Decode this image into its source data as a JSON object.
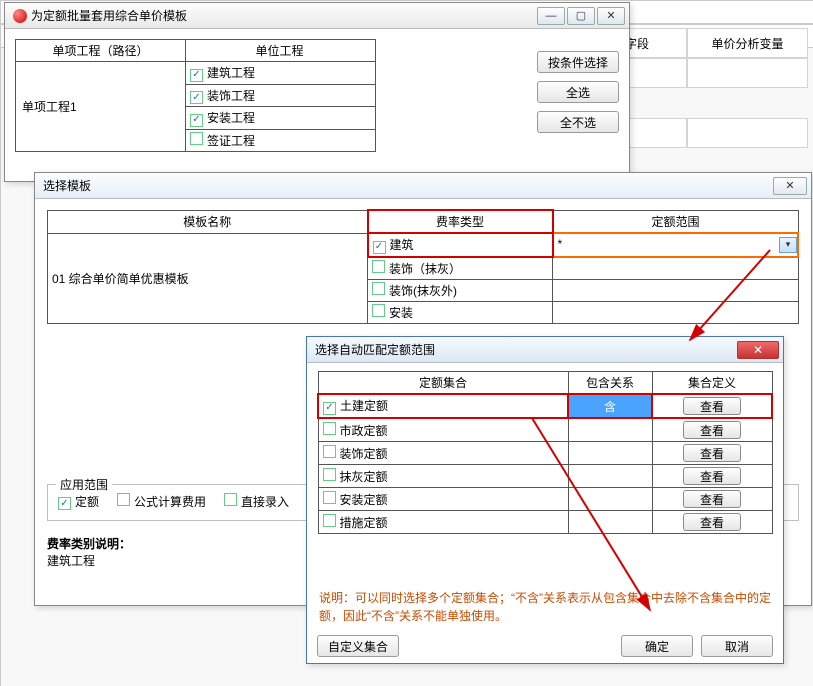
{
  "bg": {
    "col_a_header": "字段",
    "col_b_header": "单价分析变量",
    "row1_a": ""
  },
  "d1": {
    "title": "为定额批量套用综合单价模板",
    "col_path": "单项工程（路径）",
    "col_unit": "单位工程",
    "path_val": "单项工程1",
    "units": [
      {
        "label": "建筑工程",
        "on": true
      },
      {
        "label": "装饰工程",
        "on": true
      },
      {
        "label": "安装工程",
        "on": true
      },
      {
        "label": "签证工程",
        "on": false
      }
    ],
    "btn_filter": "按条件选择",
    "btn_all": "全选",
    "btn_none": "全不选"
  },
  "d2": {
    "title": "选择模板",
    "col_name": "模板名称",
    "col_rate": "费率类型",
    "col_range": "定额范围",
    "name_val": "01 综合单价简单优惠模板",
    "star": "*",
    "rates": [
      {
        "label": "建筑",
        "on": true,
        "hl": true
      },
      {
        "label": "装饰（抹灰）",
        "on": false
      },
      {
        "label": "装饰(抹灰外)",
        "on": false
      },
      {
        "label": "安装",
        "on": false
      }
    ],
    "scope_label": "应用范围",
    "scope_items": [
      {
        "label": "定额",
        "on": true
      },
      {
        "label": "公式计算费用",
        "on": false
      },
      {
        "label": "直接录入",
        "on": false
      }
    ],
    "note_label": "费率类别说明：",
    "note_body": "建筑工程"
  },
  "d3": {
    "title": "选择自动匹配定额范围",
    "col_set": "定额集合",
    "col_rel": "包含关系",
    "col_def": "集合定义",
    "btn_view": "查看",
    "rel_contain": "含",
    "rows": [
      {
        "label": "土建定额",
        "on": true,
        "hl": true
      },
      {
        "label": "市政定额",
        "on": false
      },
      {
        "label": "装饰定额",
        "on": false
      },
      {
        "label": "抹灰定额",
        "on": false
      },
      {
        "label": "安装定额",
        "on": false
      },
      {
        "label": "措施定额",
        "on": false
      }
    ],
    "desc": "说明：可以同时选择多个定额集合；“不含”关系表示从包含集合中去除不含集合中的定额，因此“不含”关系不能单独使用。",
    "btn_custom": "自定义集合",
    "btn_ok": "确定",
    "btn_cancel": "取消"
  }
}
